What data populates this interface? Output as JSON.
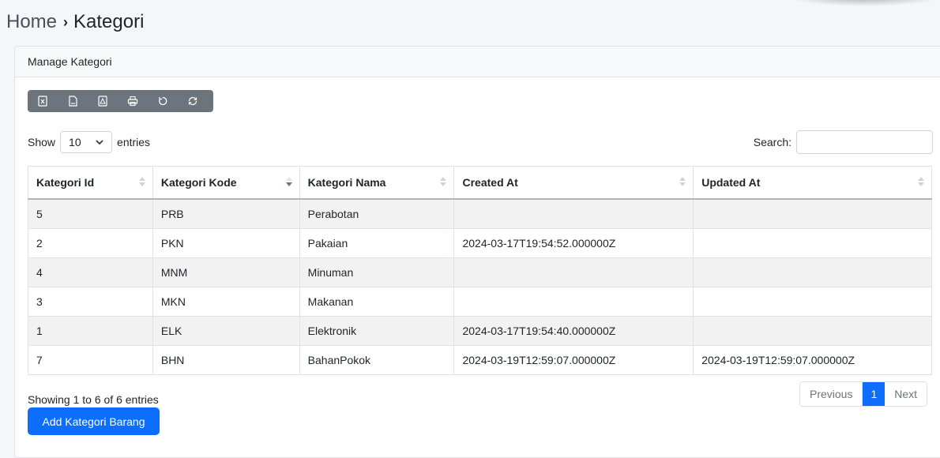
{
  "breadcrumb": {
    "home": "Home",
    "separator": "›",
    "current": "Kategori"
  },
  "card": {
    "title": "Manage Kategori"
  },
  "toolbar": {
    "buttons": [
      {
        "icon": "excel-file-icon"
      },
      {
        "icon": "csv-file-icon"
      },
      {
        "icon": "pdf-file-icon"
      },
      {
        "icon": "printer-icon"
      },
      {
        "icon": "rotate-icon"
      },
      {
        "icon": "refresh-icon"
      }
    ]
  },
  "length": {
    "show_label": "Show",
    "value": "10",
    "entries_label": "entries"
  },
  "search": {
    "label": "Search:",
    "value": "",
    "placeholder": ""
  },
  "table": {
    "headers": [
      "Kategori Id",
      "Kategori Kode",
      "Kategori Nama",
      "Created At",
      "Updated At"
    ],
    "sorted_column": "Kategori Kode",
    "sort_direction": "desc",
    "rows": [
      [
        "5",
        "PRB",
        "Perabotan",
        "",
        ""
      ],
      [
        "2",
        "PKN",
        "Pakaian",
        "2024-03-17T19:54:52.000000Z",
        ""
      ],
      [
        "4",
        "MNM",
        "Minuman",
        "",
        ""
      ],
      [
        "3",
        "MKN",
        "Makanan",
        "",
        ""
      ],
      [
        "1",
        "ELK",
        "Elektronik",
        "2024-03-17T19:54:40.000000Z",
        ""
      ],
      [
        "7",
        "BHN",
        "BahanPokok",
        "2024-03-19T12:59:07.000000Z",
        "2024-03-19T12:59:07.000000Z"
      ]
    ]
  },
  "info": "Showing 1 to 6 of 6 entries",
  "pagination": {
    "previous": "Previous",
    "current_page": "1",
    "next": "Next"
  },
  "add_button": "Add Kategori Barang",
  "colors": {
    "primary": "#0d6efd",
    "toolbar": "#6c757d",
    "stripe": "#f2f2f2"
  }
}
